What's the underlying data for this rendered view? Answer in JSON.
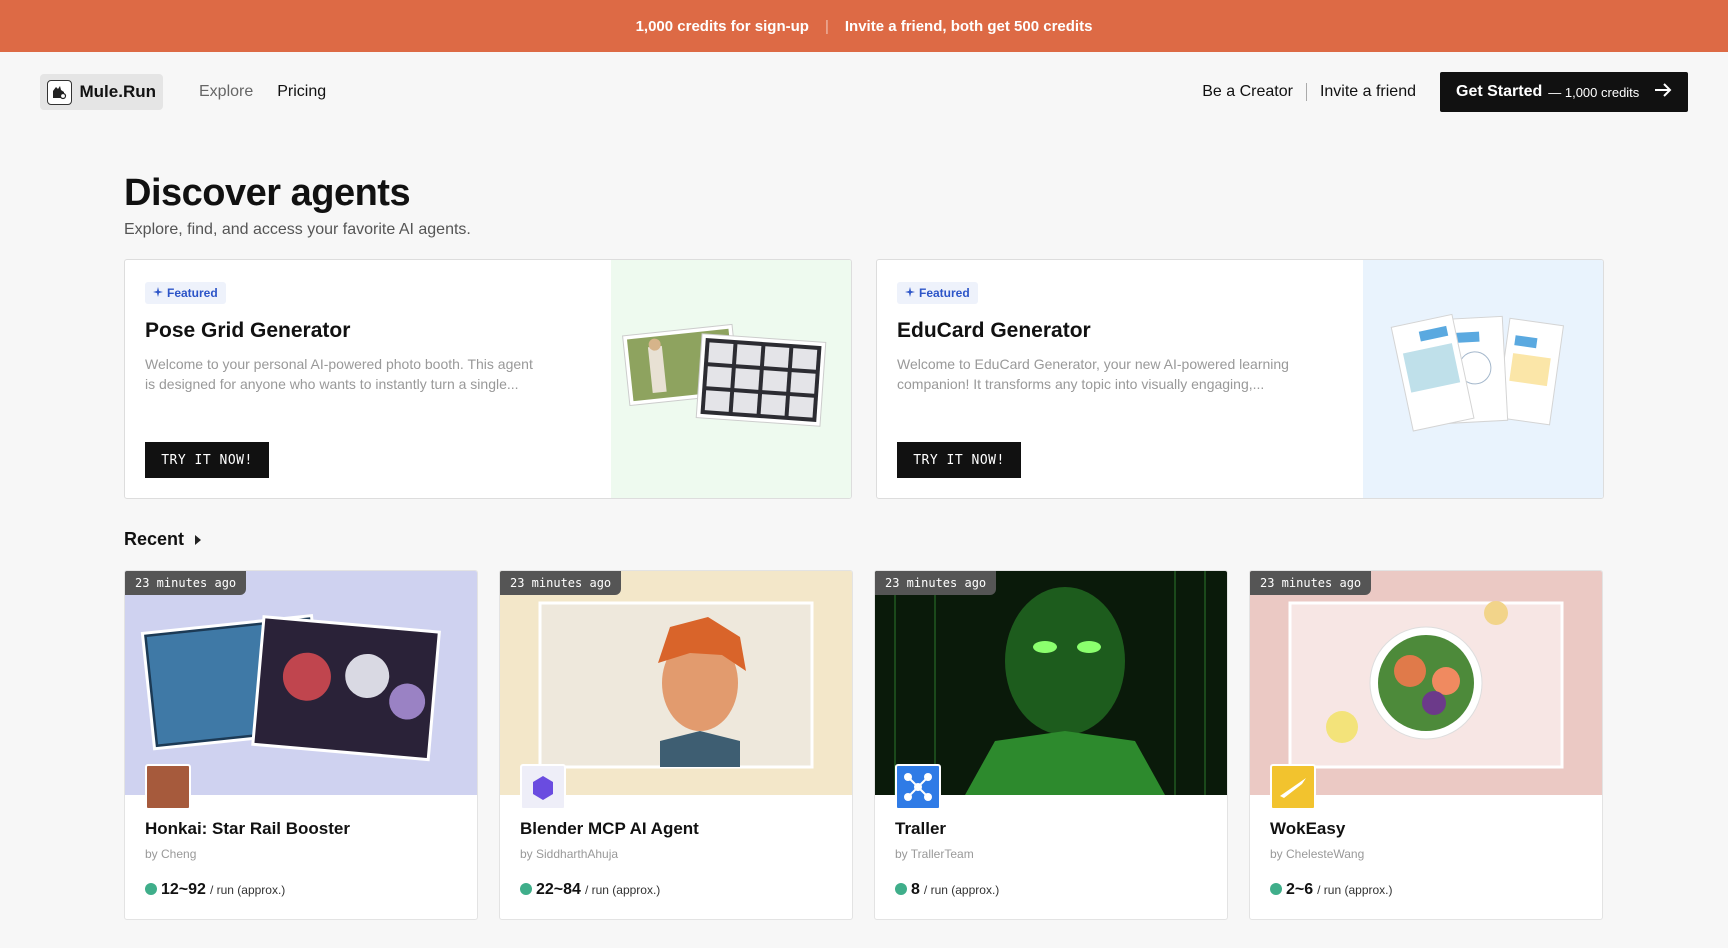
{
  "promo": {
    "left": "1,000 credits for sign-up",
    "separator": "|",
    "right": "Invite a friend, both get 500 credits"
  },
  "nav": {
    "logo_text": "Mule.Run",
    "links": [
      "Explore",
      "Pricing"
    ],
    "creator": "Be a Creator",
    "invite": "Invite a friend",
    "cta_label": "Get Started",
    "cta_sub": "— 1,000 credits",
    "cta_icon": "arrow-right-icon"
  },
  "page": {
    "title": "Discover agents",
    "subtitle": "Explore, find, and access your favorite AI agents."
  },
  "featured": [
    {
      "badge": "Featured",
      "title": "Pose Grid Generator",
      "desc1": "Welcome to your personal AI-powered photo booth. This agent",
      "desc2": "is designed for anyone who wants to instantly turn a single...",
      "button": "TRY IT NOW!",
      "bg": "#eefaef"
    },
    {
      "badge": "Featured",
      "title": "EduCard Generator",
      "desc1": "Welcome to EduCard Generator, your new AI-powered learning",
      "desc2": "companion! It transforms any topic into visually engaging,...",
      "button": "TRY IT NOW!",
      "bg": "#e9f3fd"
    }
  ],
  "recent": {
    "heading": "Recent",
    "agents": [
      {
        "time": "23 minutes ago",
        "name": "Honkai: Star Rail Booster",
        "author": "by Cheng",
        "price": "12~92",
        "unit": "/ run (approx.)",
        "cover_bg": "#cfd2f0"
      },
      {
        "time": "23 minutes ago",
        "name": "Blender MCP AI Agent",
        "author": "by SiddharthAhuja",
        "price": "22~84",
        "unit": "/ run (approx.)",
        "cover_bg": "#f3e7c9"
      },
      {
        "time": "23 minutes ago",
        "name": "Traller",
        "author": "by TrallerTeam",
        "price": "8",
        "unit": "/ run (approx.)",
        "cover_bg": "#0a1a0a"
      },
      {
        "time": "23 minutes ago",
        "name": "WokEasy",
        "author": "by ChelesteWang",
        "price": "2~6",
        "unit": "/ run (approx.)",
        "cover_bg": "#ebc9c4"
      }
    ]
  },
  "colors": {
    "promo": "#dd6a45",
    "accent_blue": "#2d55c8",
    "price_dot": "#3fae8a"
  }
}
